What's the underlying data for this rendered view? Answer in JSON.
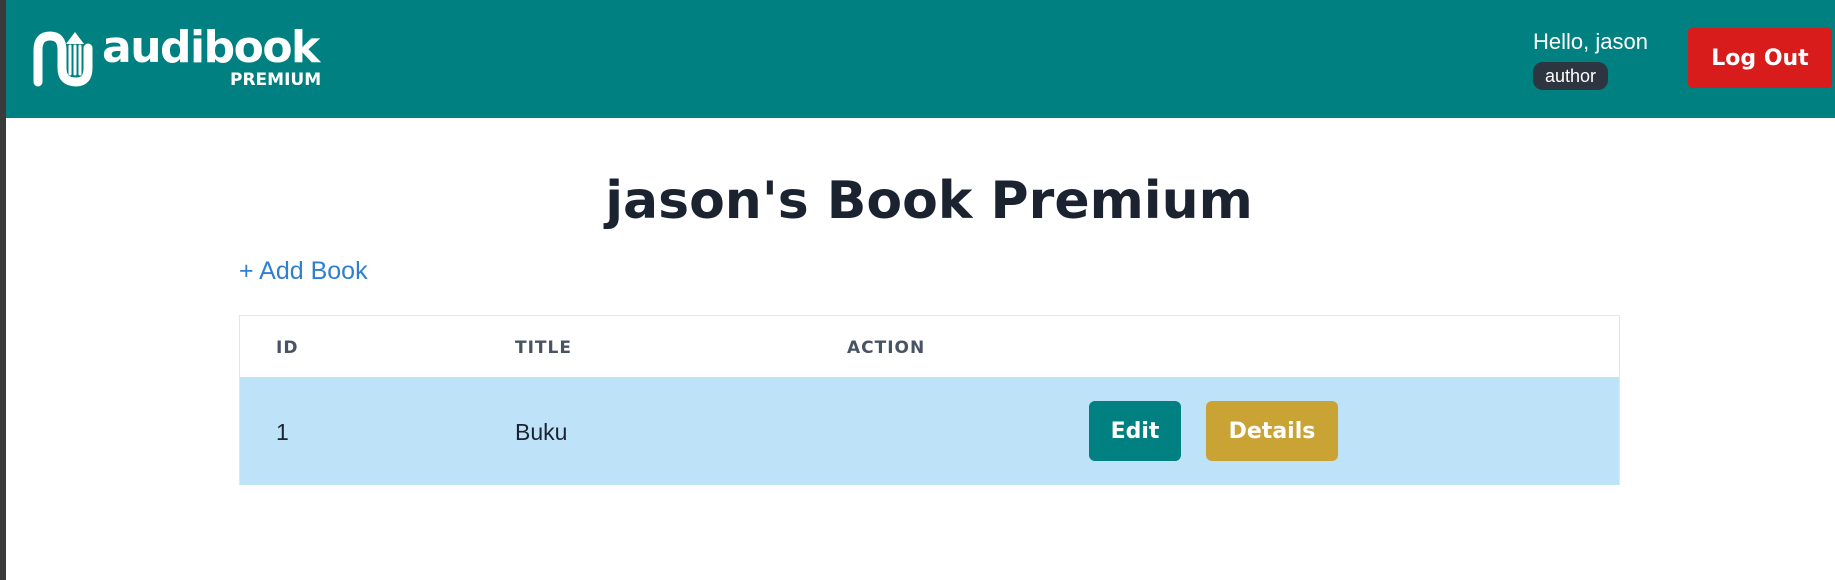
{
  "header": {
    "logo_word": "audibook",
    "logo_sub": "PREMIUM",
    "greeting": "Hello, jason",
    "role": "author",
    "logout_label": "Log Out"
  },
  "main": {
    "title": "jason's Book Premium",
    "add_book_label": "+ Add Book",
    "table": {
      "columns": [
        "ID",
        "TITLE",
        "ACTION"
      ],
      "rows": [
        {
          "id": "1",
          "title": "Buku",
          "edit_label": "Edit",
          "details_label": "Details"
        }
      ]
    }
  },
  "colors": {
    "navbar": "#008080",
    "logout": "#d81b1b",
    "edit": "#008080",
    "details": "#c9a434",
    "row_highlight": "#bee3f8",
    "link": "#2f7fd3"
  },
  "icons": {
    "logo": "audiobook-logo-icon"
  }
}
